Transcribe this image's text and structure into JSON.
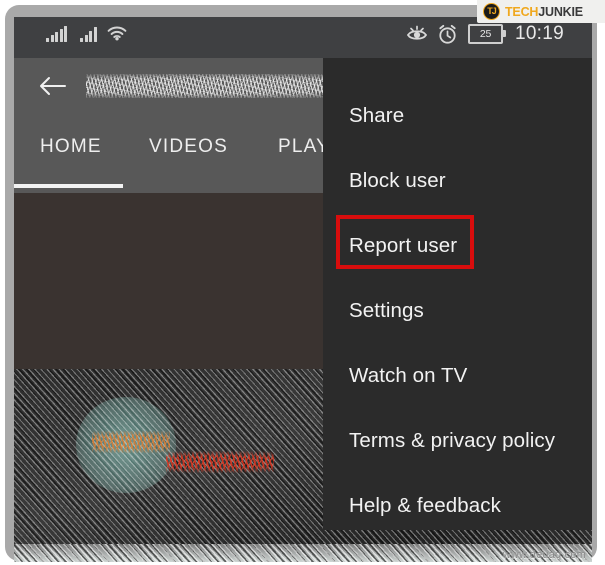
{
  "device": {
    "status_bar": {
      "signal_1_icon": "signal-bars-icon",
      "signal_2_icon": "signal-bars-icon",
      "wifi_icon": "wifi-icon",
      "eye_icon": "eye-care-icon",
      "alarm_icon": "alarm-clock-icon",
      "battery_level": "25",
      "time": "10:19"
    }
  },
  "watermark": {
    "logo_mark": "TJ",
    "logo_text_1": "TECH",
    "logo_text_2": "JUNKIE",
    "site": "www.deuaq.com"
  },
  "app": {
    "back_icon": "back-arrow-icon",
    "title": "",
    "tabs": [
      {
        "label": "HOME",
        "selected": true
      },
      {
        "label": "VIDEOS",
        "selected": false
      },
      {
        "label": "PLAY",
        "selected": false
      }
    ]
  },
  "overflow_menu": {
    "items": [
      {
        "label": "Share",
        "highlighted": false
      },
      {
        "label": "Block user",
        "highlighted": false
      },
      {
        "label": "Report user",
        "highlighted": true
      },
      {
        "label": "Settings",
        "highlighted": false
      },
      {
        "label": "Watch on TV",
        "highlighted": false
      },
      {
        "label": "Terms & privacy policy",
        "highlighted": false
      },
      {
        "label": "Help & feedback",
        "highlighted": false
      }
    ]
  },
  "colors": {
    "status_bar": "#3f4042",
    "toolbar": "#585858",
    "menu_background": "#2b2b2b",
    "menu_text": "#f2f2f2",
    "highlight_border": "#d80d0d",
    "bezel": "#a9a9a9",
    "logo_accent": "#f0a81e"
  }
}
